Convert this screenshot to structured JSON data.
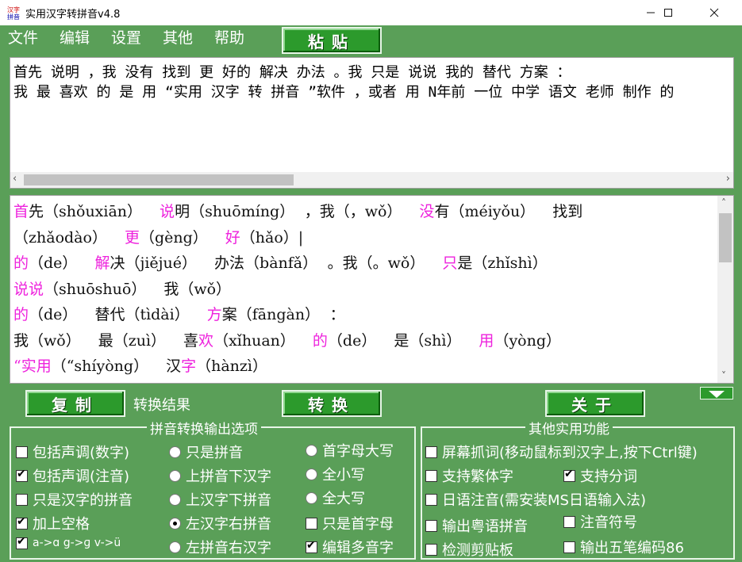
{
  "window": {
    "title": "实用汉字转拼音v4.8",
    "controls": {
      "minimize": "—",
      "maximize": "☐",
      "close": "✕"
    }
  },
  "menu": [
    "文件",
    "编辑",
    "设置",
    "其他",
    "帮助"
  ],
  "buttons": {
    "paste": "粘贴",
    "copy": "复制",
    "convert": "转换",
    "about": "关于"
  },
  "result_label": "转换结果",
  "input": {
    "lines": [
      "首先 说明 ，我 没有 找到 更 好的 解决 办法 。我 只是 说说 我的 替代 方案 ：",
      "我 最 喜欢 的 是 用 “实用 汉字 转 拼音 ”软件 ，或者 用 N年前 一位 中学 语文 老师 制作 的"
    ]
  },
  "output": {
    "lines": [
      [
        {
          "segs": [
            {
              "t": "首",
              "p": true
            },
            {
              "t": "先（shǒuxiān）",
              "p": false
            }
          ]
        },
        {
          "segs": [
            {
              "t": "说",
              "p": true
            },
            {
              "t": "明（shuōmíng）",
              "p": false
            }
          ]
        },
        {
          "segs": [
            {
              "t": "，我（，wǒ）",
              "p": false
            }
          ]
        },
        {
          "segs": [
            {
              "t": "没",
              "p": true
            },
            {
              "t": "有（méiyǒu）",
              "p": false
            }
          ]
        },
        {
          "segs": [
            {
              "t": "找到",
              "p": false
            }
          ]
        }
      ],
      [
        {
          "segs": [
            {
              "t": "（zhǎodào）",
              "p": false
            }
          ]
        },
        {
          "segs": [
            {
              "t": "更",
              "p": true
            },
            {
              "t": "（gèng）",
              "p": false
            }
          ]
        },
        {
          "segs": [
            {
              "t": "好",
              "p": true
            },
            {
              "t": "（hǎo）|",
              "p": false
            }
          ]
        }
      ],
      [
        {
          "segs": [
            {
              "t": "的",
              "p": true
            },
            {
              "t": "（de）",
              "p": false
            }
          ]
        },
        {
          "segs": [
            {
              "t": "解",
              "p": true
            },
            {
              "t": "决（jiějué）",
              "p": false
            }
          ]
        },
        {
          "segs": [
            {
              "t": "办法（bànfǎ）",
              "p": false
            }
          ]
        },
        {
          "segs": [
            {
              "t": "。我（。wǒ）",
              "p": false
            }
          ]
        },
        {
          "segs": [
            {
              "t": "只",
              "p": true
            },
            {
              "t": "是（zhǐshì）",
              "p": false
            }
          ]
        }
      ],
      [
        {
          "segs": [
            {
              "t": "说说",
              "p": true
            },
            {
              "t": "（shuōshuō）",
              "p": false
            }
          ]
        },
        {
          "segs": [
            {
              "t": "我（wǒ）",
              "p": false
            }
          ]
        }
      ],
      [
        {
          "segs": [
            {
              "t": "的",
              "p": true
            },
            {
              "t": "（de）",
              "p": false
            }
          ]
        },
        {
          "segs": [
            {
              "t": "替代（tìdài）",
              "p": false
            }
          ]
        },
        {
          "segs": [
            {
              "t": "方",
              "p": true
            },
            {
              "t": "案（fāngàn）",
              "p": false
            }
          ]
        },
        {
          "segs": [
            {
              "t": "：",
              "p": false
            }
          ]
        }
      ],
      [
        {
          "segs": [
            {
              "t": "我（wǒ）",
              "p": false
            }
          ]
        },
        {
          "segs": [
            {
              "t": "最（zuì）",
              "p": false
            }
          ]
        },
        {
          "segs": [
            {
              "t": "喜",
              "p": false
            },
            {
              "t": "欢",
              "p": true
            },
            {
              "t": "（xǐhuan）",
              "p": false
            }
          ]
        },
        {
          "segs": [
            {
              "t": "的",
              "p": true
            },
            {
              "t": "（de）",
              "p": false
            }
          ]
        },
        {
          "segs": [
            {
              "t": "是（shì）",
              "p": false
            }
          ]
        },
        {
          "segs": [
            {
              "t": "用",
              "p": true
            },
            {
              "t": "（yòng）",
              "p": false
            }
          ]
        }
      ],
      [
        {
          "segs": [
            {
              "t": "“实用",
              "p": true
            },
            {
              "t": "（“shíyòng）",
              "p": false
            }
          ]
        },
        {
          "segs": [
            {
              "t": "汉",
              "p": false
            },
            {
              "t": "字",
              "p": true
            },
            {
              "t": "（hànzì）",
              "p": false
            }
          ]
        }
      ]
    ]
  },
  "group_left": {
    "title": "拼音转换输出选项",
    "options": [
      {
        "label": "包括声调(数字)",
        "type": "checkbox",
        "checked": false
      },
      {
        "label": "包括声调(注音)",
        "type": "checkbox",
        "checked": true
      },
      {
        "label": "只是汉字的拼音",
        "type": "checkbox",
        "checked": false
      },
      {
        "label": "加上空格",
        "type": "checkbox",
        "checked": true
      },
      {
        "label": "a->ɑ g->ɡ v->ü",
        "type": "checkbox",
        "checked": true
      },
      {
        "label": "只是拼音",
        "type": "radio",
        "checked": false
      },
      {
        "label": "上拼音下汉字",
        "type": "radio",
        "checked": false
      },
      {
        "label": "上汉字下拼音",
        "type": "radio",
        "checked": false
      },
      {
        "label": "左汉字右拼音",
        "type": "radio",
        "checked": true
      },
      {
        "label": "左拼音右汉字",
        "type": "radio",
        "checked": false
      },
      {
        "label": "首字母大写",
        "type": "radio",
        "checked": false
      },
      {
        "label": "全小写",
        "type": "radio",
        "checked": false
      },
      {
        "label": "全大写",
        "type": "radio",
        "checked": false
      },
      {
        "label": "只是首字母",
        "type": "checkbox",
        "checked": false
      },
      {
        "label": "编辑多音字",
        "type": "checkbox",
        "checked": true
      }
    ]
  },
  "group_right": {
    "title": "其他实用功能",
    "options": [
      {
        "label": "屏幕抓词(移动鼠标到汉字上,按下Ctrl键)",
        "type": "checkbox",
        "checked": false
      },
      {
        "label": "支持繁体字",
        "type": "checkbox",
        "checked": false
      },
      {
        "label": "支持分词",
        "type": "checkbox",
        "checked": true
      },
      {
        "label": "日语注音(需安装MS日语输入法)",
        "type": "checkbox",
        "checked": false
      },
      {
        "label": "输出粤语拼音",
        "type": "checkbox",
        "checked": false
      },
      {
        "label": "注音符号",
        "type": "checkbox",
        "checked": false
      },
      {
        "label": "检测剪贴板",
        "type": "checkbox",
        "checked": false
      },
      {
        "label": "输出五笔编码86",
        "type": "checkbox",
        "checked": false
      }
    ]
  },
  "colors": {
    "background": "#5a9f58",
    "button": "#2c9a2c",
    "highlight": "#ee22dd"
  }
}
